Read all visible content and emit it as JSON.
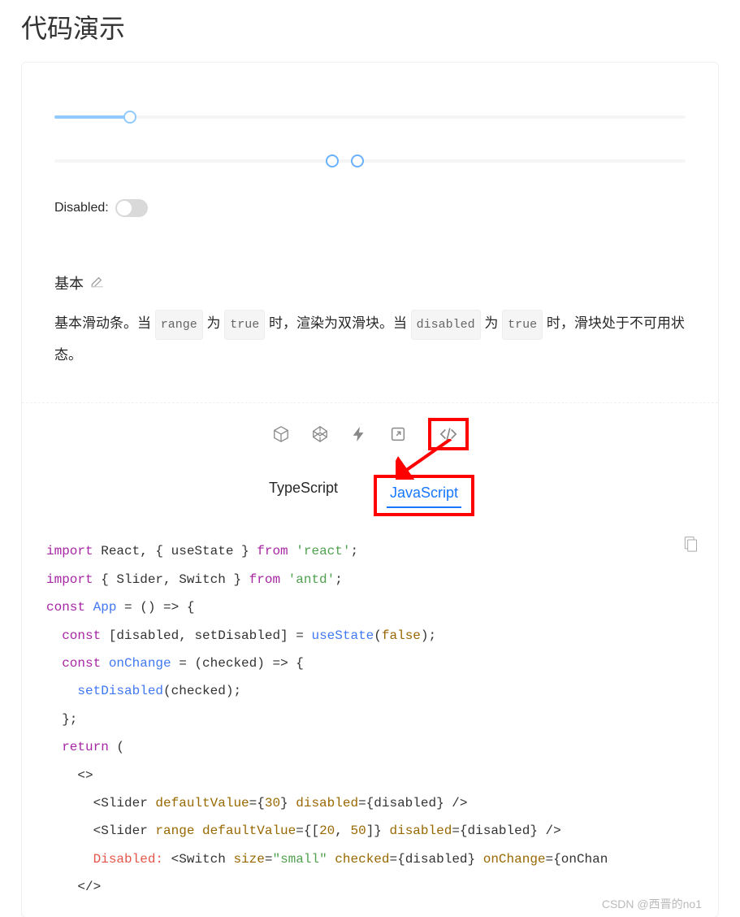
{
  "page": {
    "title": "代码演示"
  },
  "example": {
    "title": "基本",
    "desc": {
      "t1": "基本滑动条。当 ",
      "code1": "range",
      "t2": " 为 ",
      "code2": "true",
      "t3": " 时，渲染为双滑块。当 ",
      "code3": "disabled",
      "t4": " 为 ",
      "code4": "true",
      "t5": " 时，滑块处于不可用状态。"
    },
    "disabled_label": "Disabled:",
    "slider1": {
      "value": 30,
      "track_percent": 12
    },
    "slider2": {
      "lo": 20,
      "hi": 50,
      "lo_percent": 44,
      "hi_percent": 50
    }
  },
  "tabs": {
    "ts": "TypeScript",
    "js": "JavaScript",
    "active": "js"
  },
  "code": {
    "l1a": "import",
    "l1b": " React, { useState } ",
    "l1c": "from",
    "l1d": " 'react'",
    "l1e": ";",
    "l2a": "import",
    "l2b": " { Slider, Switch } ",
    "l2c": "from",
    "l2d": " 'antd'",
    "l2e": ";",
    "l3a": "const",
    "l3b": " App",
    "l3c": " = () => {",
    "l4a": "  const",
    "l4b": " [disabled, setDisabled] = ",
    "l4c": "useState",
    "l4d": "(",
    "l4e": "false",
    "l4f": ");",
    "l5a": "  const",
    "l5b": " onChange",
    "l5c": " = (checked) => {",
    "l6a": "    setDisabled",
    "l6b": "(checked);",
    "l7": "  };",
    "l8a": "  return",
    "l8b": " (",
    "l9": "    <>",
    "l10a": "      <Slider ",
    "l10b": "defaultValue",
    "l10c": "={",
    "l10d": "30",
    "l10e": "} ",
    "l10f": "disabled",
    "l10g": "={disabled} />",
    "l11a": "      <Slider ",
    "l11b": "range",
    "l11c": " defaultValue",
    "l11d": "={[",
    "l11e": "20",
    "l11f": ", ",
    "l11g": "50",
    "l11h": "]} ",
    "l11i": "disabled",
    "l11j": "={disabled} />",
    "l12a": "      Disabled:",
    "l12b": " <Switch ",
    "l12c": "size",
    "l12d": "=",
    "l12e": "\"small\"",
    "l12f": " checked",
    "l12g": "={disabled} ",
    "l12h": "onChange",
    "l12i": "={onChan",
    "l13": "    </>"
  },
  "watermark": "CSDN @西晋的no1"
}
